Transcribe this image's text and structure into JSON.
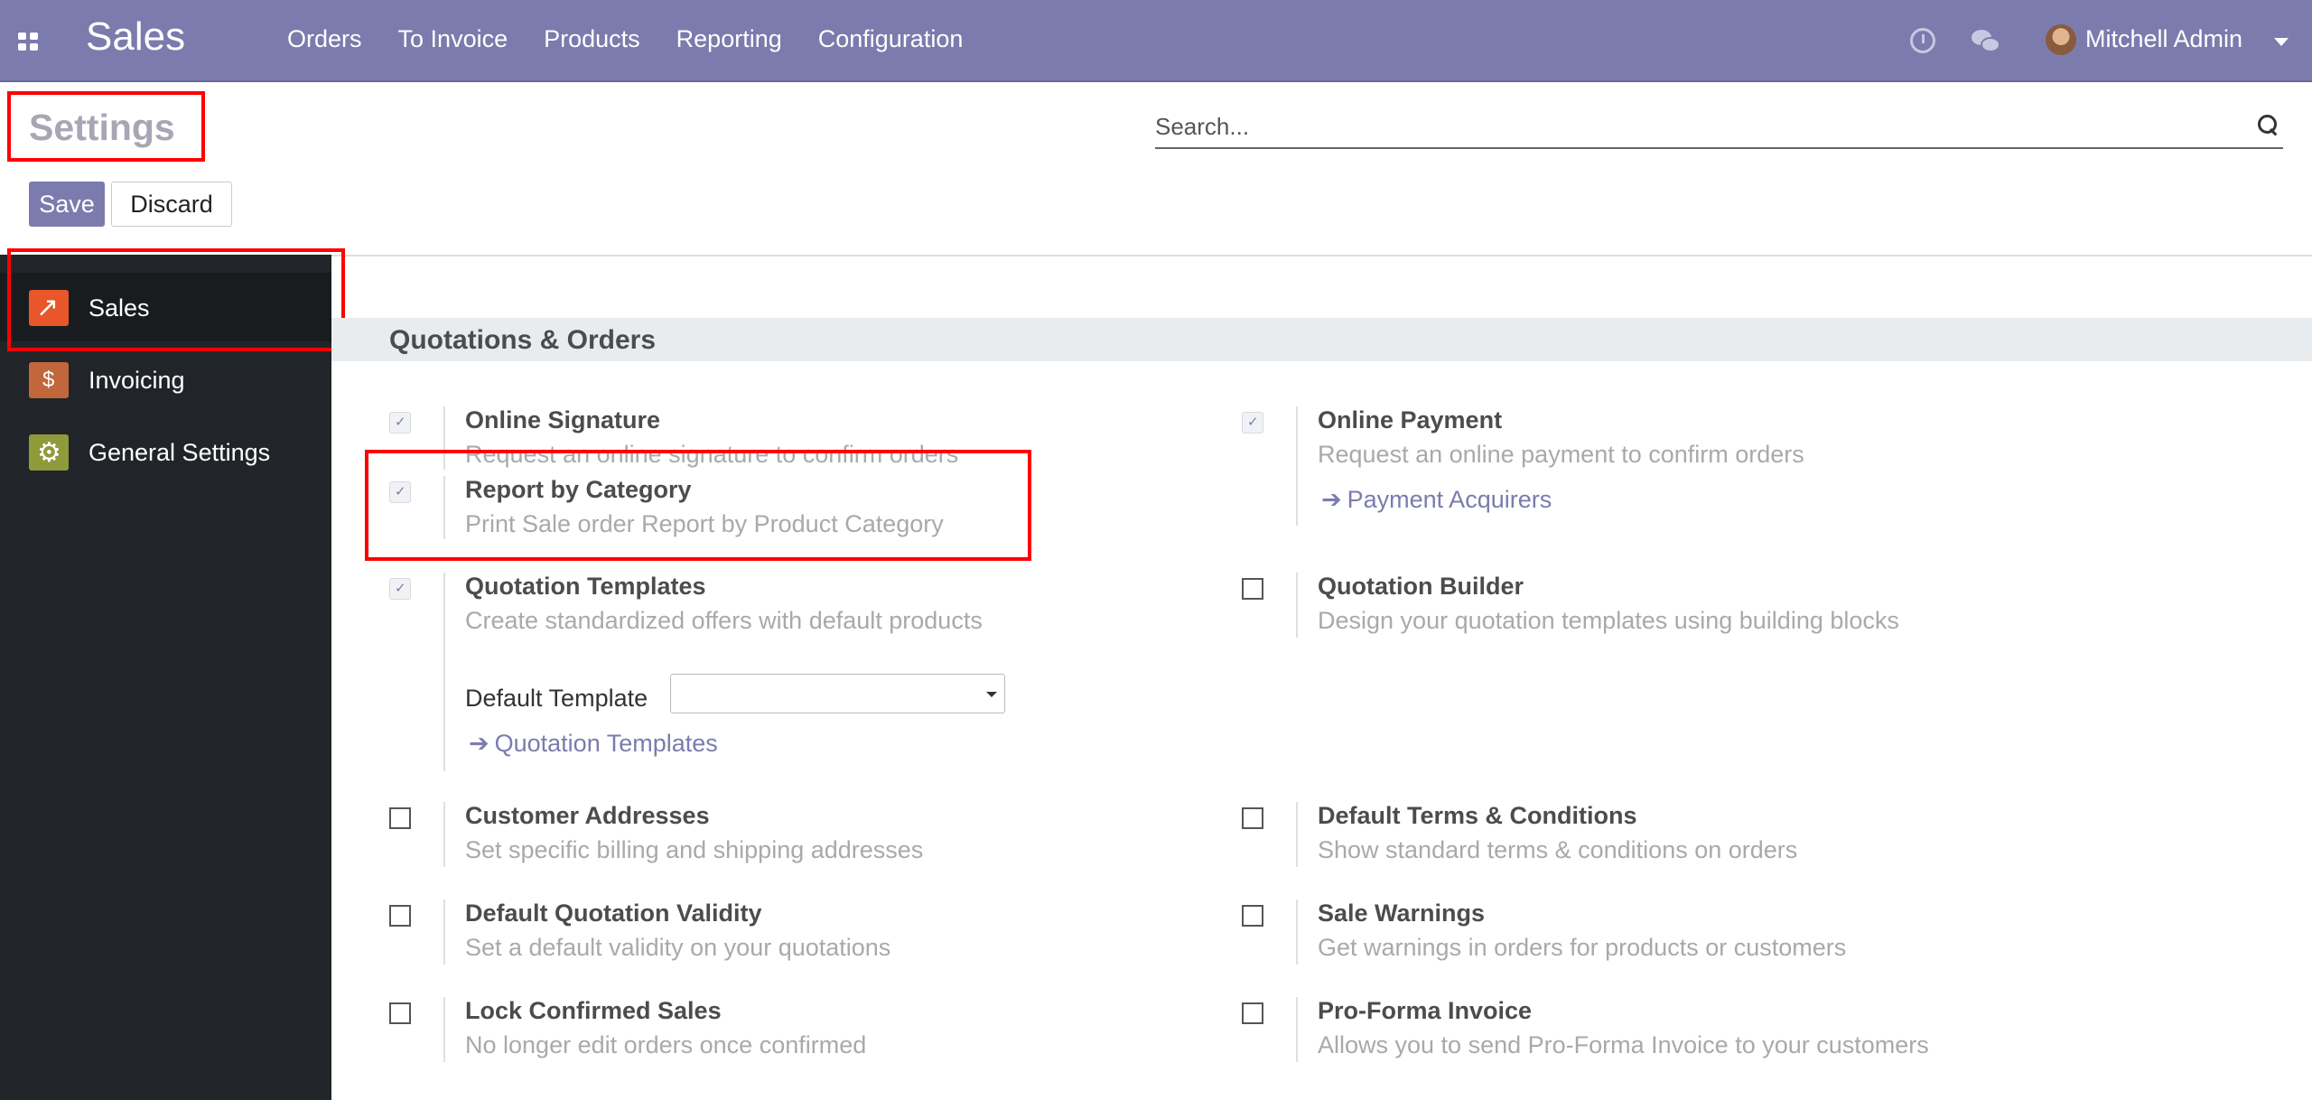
{
  "navbar": {
    "app_name": "Sales",
    "menu": [
      "Orders",
      "To Invoice",
      "Products",
      "Reporting",
      "Configuration"
    ],
    "user_name": "Mitchell Admin",
    "icons": {
      "apps": "apps-grid-icon",
      "activity": "clock-icon",
      "messages": "chat-icon"
    }
  },
  "control_panel": {
    "title": "Settings",
    "search_placeholder": "Search...",
    "save_label": "Save",
    "discard_label": "Discard"
  },
  "sidebar": {
    "items": [
      {
        "label": "Sales",
        "icon": "sales-chart-icon",
        "active": true
      },
      {
        "label": "Invoicing",
        "icon": "invoice-icon",
        "active": false
      },
      {
        "label": "General Settings",
        "icon": "gear-icon",
        "active": false
      }
    ]
  },
  "section": {
    "title": "Quotations & Orders",
    "settings": {
      "online_signature": {
        "name": "Online Signature",
        "desc": "Request an online signature to confirm orders",
        "checked": true
      },
      "online_payment": {
        "name": "Online Payment",
        "desc": "Request an online payment to confirm orders",
        "checked": true,
        "link": "Payment Acquirers"
      },
      "report_by_category": {
        "name": "Report by Category",
        "desc": "Print Sale order Report by Product Category",
        "checked": true
      },
      "quotation_templates": {
        "name": "Quotation Templates",
        "desc": "Create standardized offers with default products",
        "checked": true,
        "field_label": "Default Template",
        "field_value": "",
        "link": "Quotation Templates"
      },
      "quotation_builder": {
        "name": "Quotation Builder",
        "desc": "Design your quotation templates using building blocks",
        "checked": false
      },
      "customer_addresses": {
        "name": "Customer Addresses",
        "desc": "Set specific billing and shipping addresses",
        "checked": false
      },
      "default_terms": {
        "name": "Default Terms & Conditions",
        "desc": "Show standard terms & conditions on orders",
        "checked": false
      },
      "default_validity": {
        "name": "Default Quotation Validity",
        "desc": "Set a default validity on your quotations",
        "checked": false
      },
      "sale_warnings": {
        "name": "Sale Warnings",
        "desc": "Get warnings in orders for products or customers",
        "checked": false
      },
      "lock_confirmed": {
        "name": "Lock Confirmed Sales",
        "desc": "No longer edit orders once confirmed",
        "checked": false
      },
      "pro_forma": {
        "name": "Pro-Forma Invoice",
        "desc": "Allows you to send Pro-Forma Invoice to your customers",
        "checked": false
      }
    }
  },
  "colors": {
    "brand": "#7c7bad",
    "highlight": "#ff0000",
    "sidebar_bg": "#212529"
  }
}
